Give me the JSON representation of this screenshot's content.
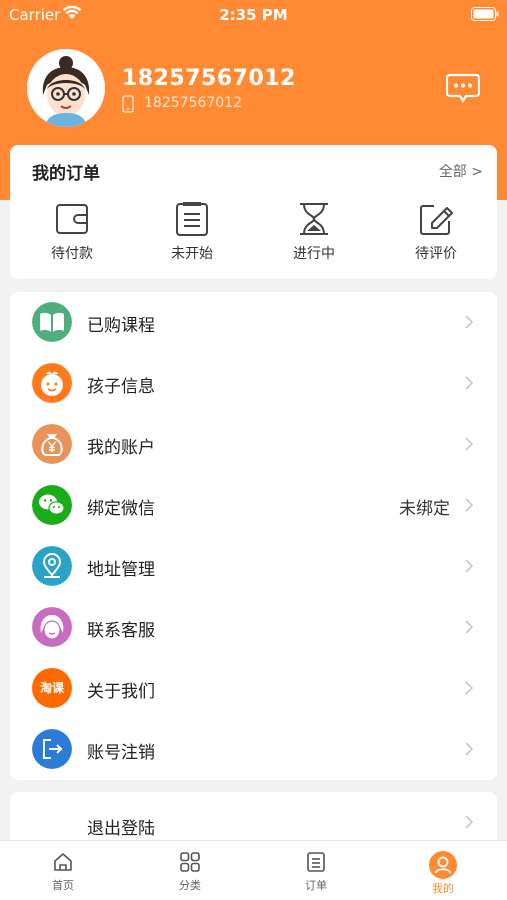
{
  "status_bar": {
    "carrier": "Carrier",
    "time": "2:35 PM"
  },
  "profile": {
    "username": "18257567012",
    "phone": "18257567012"
  },
  "orders": {
    "title": "我的订单",
    "all_label": "全部 >",
    "items": [
      {
        "label": "待付款",
        "icon": "wallet-icon"
      },
      {
        "label": "未开始",
        "icon": "clipboard-icon"
      },
      {
        "label": "进行中",
        "icon": "hourglass-icon"
      },
      {
        "label": "待评价",
        "icon": "edit-icon"
      }
    ]
  },
  "menu": {
    "items": [
      {
        "label": "已购课程",
        "icon": "book-icon",
        "color": "#4caf7d"
      },
      {
        "label": "孩子信息",
        "icon": "child-face-icon",
        "color": "#ff7a1a"
      },
      {
        "label": "我的账户",
        "icon": "money-bag-icon",
        "color": "#e8935a"
      },
      {
        "label": "绑定微信",
        "icon": "wechat-icon",
        "color": "#1aad19",
        "value": "未绑定"
      },
      {
        "label": "地址管理",
        "icon": "location-icon",
        "color": "#2aa3c7"
      },
      {
        "label": "联系客服",
        "icon": "customer-service-icon",
        "color": "#c96bbf"
      },
      {
        "label": "关于我们",
        "icon": "taoke-logo-icon",
        "color": "#ff6a00",
        "badge": "淘课"
      },
      {
        "label": "账号注销",
        "icon": "exit-icon",
        "color": "#2d7bd6"
      }
    ]
  },
  "logout": {
    "label": "退出登陆"
  },
  "tab_bar": {
    "items": [
      {
        "label": "首页",
        "icon": "home-icon"
      },
      {
        "label": "分类",
        "icon": "grid-icon"
      },
      {
        "label": "订单",
        "icon": "list-icon"
      },
      {
        "label": "我的",
        "icon": "profile-icon",
        "active": true
      }
    ]
  },
  "colors": {
    "accent": "#ff8a33",
    "background": "#f2f2f2"
  }
}
